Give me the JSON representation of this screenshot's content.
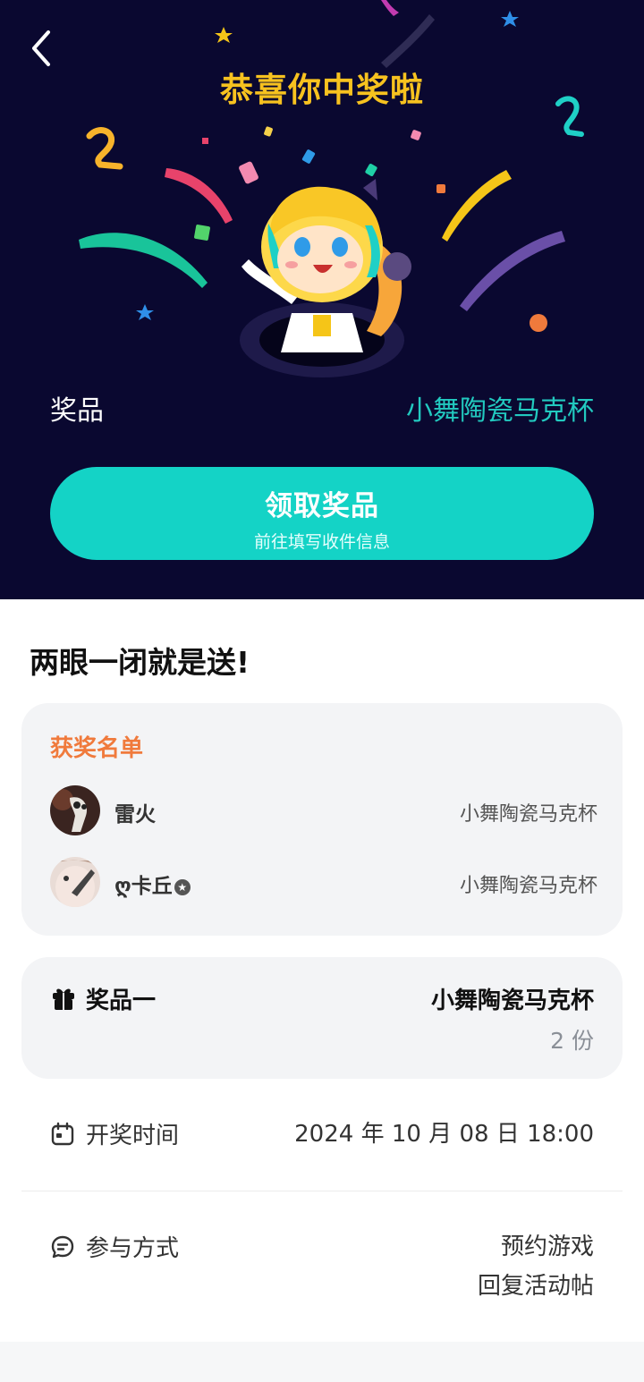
{
  "header": {
    "title": "恭喜你中奖啦"
  },
  "prize_summary": {
    "label": "奖品",
    "name": "小舞陶瓷马克杯"
  },
  "claim_button": {
    "label": "领取奖品",
    "sublabel": "前往填写收件信息"
  },
  "activity": {
    "title": "两眼一闭就是送!"
  },
  "winners": {
    "heading": "获奖名单",
    "rows": [
      {
        "name": "雷火",
        "prize": "小舞陶瓷马克杯"
      },
      {
        "name": "ღ卡丘",
        "prize": "小舞陶瓷马克杯"
      }
    ]
  },
  "prize_item": {
    "tier": "奖品一",
    "name": "小舞陶瓷马克杯",
    "count": "2 份"
  },
  "draw_time": {
    "label": "开奖时间",
    "value": "2024 年 10 月 08 日 18:00"
  },
  "participation": {
    "label": "参与方式",
    "methods": [
      "预约游戏",
      "回复活动帖"
    ]
  },
  "colors": {
    "hero_bg": "#0a0830",
    "title_gold": "#f7c21f",
    "accent_teal": "#14d3c6",
    "heading_orange": "#f07a3c"
  }
}
